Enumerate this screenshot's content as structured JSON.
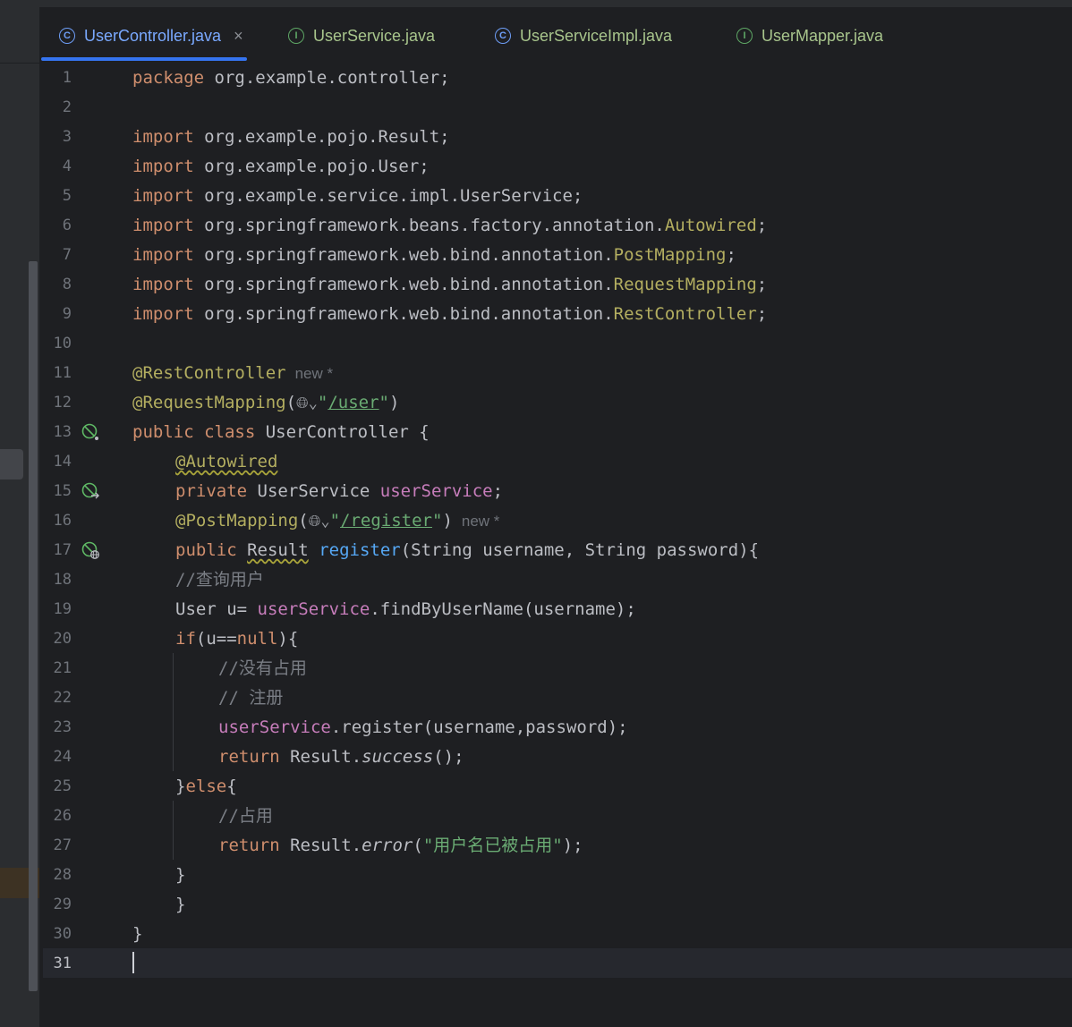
{
  "tabs": [
    {
      "label": "UserController.java",
      "icon": "class-icon",
      "active": true,
      "close": "×"
    },
    {
      "label": "UserService.java",
      "icon": "interface-icon"
    },
    {
      "label": "UserServiceImpl.java",
      "icon": "class-icon"
    },
    {
      "label": "UserMapper.java",
      "icon": "interface-icon"
    }
  ],
  "line_numbers": [
    "1",
    "2",
    "3",
    "4",
    "5",
    "6",
    "7",
    "8",
    "9",
    "10",
    "11",
    "12",
    "13",
    "14",
    "15",
    "16",
    "17",
    "18",
    "19",
    "20",
    "21",
    "22",
    "23",
    "24",
    "25",
    "26",
    "27",
    "28",
    "29",
    "30",
    "31"
  ],
  "code": {
    "l1_a": "package",
    "l1_b": " org.example.controller;",
    "l3_a": "import",
    "l3_b": " org.example.pojo.Result;",
    "l4_a": "import",
    "l4_b": " org.example.pojo.User;",
    "l5_a": "import",
    "l5_b": " org.example.service.impl.UserService;",
    "l6_a": "import",
    "l6_b": " org.springframework.beans.factory.annotation.",
    "l6_c": "Autowired",
    "l6_d": ";",
    "l7_a": "import",
    "l7_b": " org.springframework.web.bind.annotation.",
    "l7_c": "PostMapping",
    "l7_d": ";",
    "l8_a": "import",
    "l8_b": " org.springframework.web.bind.annotation.",
    "l8_c": "RequestMapping",
    "l8_d": ";",
    "l9_a": "import",
    "l9_b": " org.springframework.web.bind.annotation.",
    "l9_c": "RestController",
    "l9_d": ";",
    "l11_a": "@RestController",
    "l11_hint": "new *",
    "l12_a": "@RequestMapping",
    "l12_b": "(",
    "l12_globe": "🌐︎⌄",
    "l12_q1": "\"",
    "l12_str": "/user",
    "l12_q2": "\"",
    "l12_c": ")",
    "l13_a": "public class",
    "l13_b": " UserController {",
    "l14_a": "@Autowired",
    "l15_a": "private",
    "l15_b": " UserService ",
    "l15_c": "userService",
    "l15_d": ";",
    "l16_a": "@PostMapping",
    "l16_b": "(",
    "l16_globe": "🌐︎⌄",
    "l16_q1": "\"",
    "l16_str": "/register",
    "l16_q2": "\"",
    "l16_c": ")",
    "l16_hint": "new *",
    "l17_a": "public",
    "l17_b": "Result",
    "l17_c": "register",
    "l17_d": "(String username, String password){",
    "l18_a": "//查询用户",
    "l19_a": "User u= ",
    "l19_b": "userService",
    "l19_c": ".findByUserName(username);",
    "l20_a": "if",
    "l20_b": "(u==",
    "l20_c": "null",
    "l20_d": "){",
    "l21_a": "//没有占用",
    "l22_a": "// 注册",
    "l23_a": "userService",
    "l23_b": ".register(username,password);",
    "l24_a": "return",
    "l24_b": " Result.",
    "l24_c": "success",
    "l24_d": "();",
    "l25_a": "}",
    "l25_b": "else",
    "l25_c": "{",
    "l26_a": "//占用",
    "l27_a": "return",
    "l27_b": " Result.",
    "l27_c": "error",
    "l27_d": "(",
    "l27_e": "\"用户名已被占用\"",
    "l27_f": ");",
    "l28_a": "}",
    "l29_a": "}",
    "l30_a": "}"
  },
  "gutter_icons": [
    "spring-bean-icon",
    "spring-autowire-icon",
    "spring-web-endpoint-icon"
  ]
}
